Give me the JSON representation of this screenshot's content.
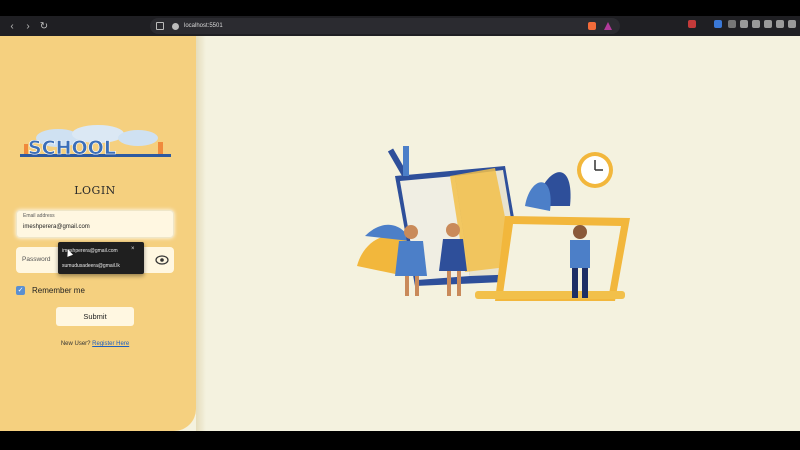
{
  "browser": {
    "url": "localhost:5501",
    "back_icon": "back-arrow-icon",
    "forward_icon": "forward-arrow-icon",
    "reload_icon": "reload-icon"
  },
  "login": {
    "logo_name": "school-logo",
    "title": "LOGIN",
    "email_label": "Email address",
    "email_value": "imeshperera@gmail.com",
    "password_label": "Password",
    "remember_label": "Remember me",
    "remember_checked": true,
    "submit_label": "Submit",
    "register_prefix": "New User?",
    "register_link": "Register Here"
  },
  "autocomplete": {
    "items": [
      "imeshperera@gmail.com",
      "sumudusadeera@gmail.lk"
    ],
    "close_label": "×"
  },
  "colors": {
    "sidebar": "#f5d07f",
    "background": "#f4f2df",
    "accent_blue": "#5b8fd0",
    "link": "#1f5fbf"
  }
}
